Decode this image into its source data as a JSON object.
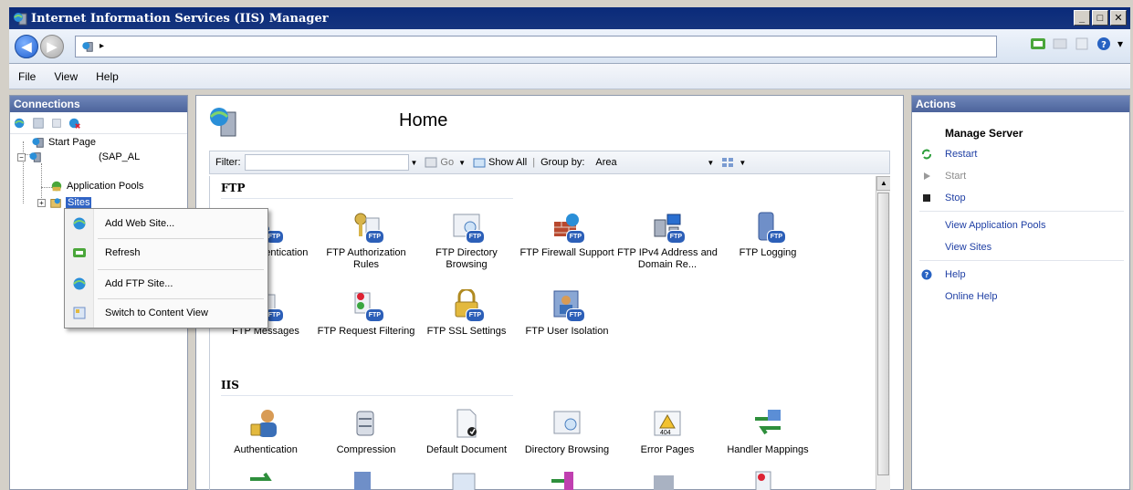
{
  "window": {
    "title": "Internet Information Services (IIS) Manager",
    "min": "_",
    "max": "□",
    "close": "✕"
  },
  "address": {
    "arrow": "▸"
  },
  "toolbar_right": {
    "dropdown": "▾"
  },
  "menu": {
    "items": [
      "File",
      "View",
      "Help"
    ]
  },
  "connections": {
    "header": "Connections",
    "tree": {
      "start_page": "Start Page",
      "server": "(SAP_AL",
      "app_pools": "Application Pools",
      "sites": "Sites"
    }
  },
  "home": {
    "title": "Home",
    "filter_label": "Filter:",
    "go_label": "Go",
    "show_all_label": "Show All",
    "group_by_label": "Group by:",
    "group_by_value": "Area",
    "sections": {
      "ftp": {
        "name": "FTP",
        "features": [
          "FTP Authentication",
          "FTP Authorization Rules",
          "FTP Directory Browsing",
          "FTP Firewall Support",
          "FTP IPv4 Address and Domain Re...",
          "FTP Logging",
          "FTP Messages",
          "FTP Request Filtering",
          "FTP SSL Settings",
          "FTP User Isolation"
        ]
      },
      "iis": {
        "name": "IIS",
        "features": [
          "Authentication",
          "Compression",
          "Default Document",
          "Directory Browsing",
          "Error Pages",
          "Handler Mappings"
        ]
      }
    },
    "ftp_tag": "FTP",
    "error_tag": "404"
  },
  "actions": {
    "header": "Actions",
    "group": "Manage Server",
    "restart": "Restart",
    "start": "Start",
    "stop": "Stop",
    "view_app_pools": "View Application Pools",
    "view_sites": "View Sites",
    "help": "Help",
    "online_help": "Online Help"
  },
  "context_menu": {
    "items": [
      "Add Web Site...",
      "Refresh",
      "Add FTP Site...",
      "Switch to Content View"
    ]
  },
  "colors": {
    "title_bar": "#0a2a7a",
    "panel_header": "#5a71a8",
    "link": "#1f3fa4",
    "selection": "#3164c5"
  }
}
